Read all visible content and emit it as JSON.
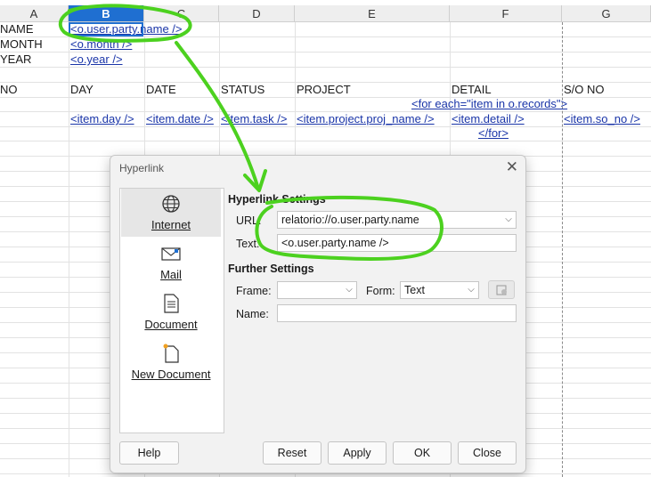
{
  "sheet": {
    "columns": [
      "A",
      "B",
      "C",
      "D",
      "E",
      "F",
      "G"
    ],
    "selected_column": "B",
    "rows": {
      "r1": {
        "a": "NAME",
        "b": "<o.user.party.name />"
      },
      "r2": {
        "a": "MONTH",
        "b": "<o.month />"
      },
      "r3": {
        "a": "YEAR",
        "b": "<o.year />"
      },
      "headers": {
        "a": "NO",
        "b": "DAY",
        "c": "DATE",
        "d": "STATUS",
        "e": "PROJECT",
        "f": "DETAIL",
        "g": "S/O NO"
      },
      "for_each": "<for each=\"item in o.records\">",
      "items": {
        "b": "<item.day />",
        "c": "<item.date />",
        "d": "<item.task />",
        "e": "<item.project.proj_name />",
        "f": "<item.detail />",
        "g": "<item.so_no />"
      },
      "end_for": "</for>"
    }
  },
  "dialog": {
    "title": "Hyperlink",
    "categories": [
      "Internet",
      "Mail",
      "Document",
      "New Document"
    ],
    "hyperlink_settings": "Hyperlink Settings",
    "url_label": "URL:",
    "url_value": "relatorio://o.user.party.name",
    "text_label": "Text:",
    "text_value": "<o.user.party.name />",
    "further_settings": "Further Settings",
    "frame_label": "Frame:",
    "frame_value": "",
    "form_label": "Form:",
    "form_value": "Text",
    "name_label": "Name:",
    "name_value": "",
    "buttons": {
      "help": "Help",
      "reset": "Reset",
      "apply": "Apply",
      "ok": "OK",
      "close": "Close"
    }
  },
  "colors": {
    "selection": "#1f6fd1",
    "link": "#1a35a8",
    "annotation": "#4cd11f"
  }
}
